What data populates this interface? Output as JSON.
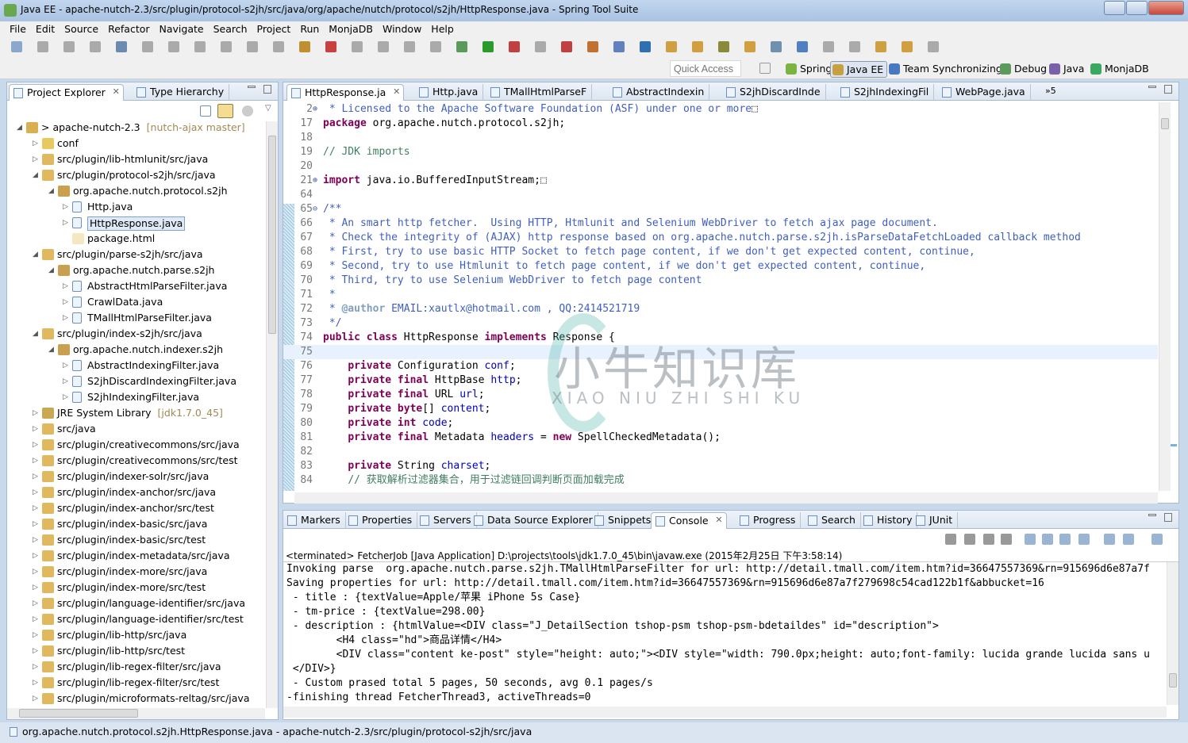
{
  "window": {
    "title": "Java EE - apache-nutch-2.3/src/plugin/protocol-s2jh/src/java/org/apache/nutch/protocol/s2jh/HttpResponse.java - Spring Tool Suite"
  },
  "menu": [
    "File",
    "Edit",
    "Source",
    "Refactor",
    "Navigate",
    "Search",
    "Project",
    "Run",
    "MonjaDB",
    "Window",
    "Help"
  ],
  "quick_access": {
    "placeholder": "Quick Access"
  },
  "perspectives": [
    {
      "label": "Spring",
      "color": "#7cb342"
    },
    {
      "label": "Java EE",
      "color": "#c8a040",
      "active": true
    },
    {
      "label": "Team Synchronizing",
      "color": "#4a78c0"
    },
    {
      "label": "Debug",
      "color": "#5a9a5a"
    },
    {
      "label": "Java",
      "color": "#7a60a8"
    },
    {
      "label": "MonjaDB",
      "color": "#3aa860"
    }
  ],
  "left_panel": {
    "tabs": [
      {
        "label": "Project Explorer",
        "active": true
      },
      {
        "label": "Type Hierarchy"
      }
    ],
    "tree": [
      {
        "level": 0,
        "exp": "open",
        "icon": "project",
        "label": "> apache-nutch-2.3",
        "deco": "[nutch-ajax master]"
      },
      {
        "level": 1,
        "exp": "closed",
        "icon": "folder",
        "label": "conf"
      },
      {
        "level": 1,
        "exp": "closed",
        "icon": "srcfolder",
        "label": "src/plugin/lib-htmlunit/src/java"
      },
      {
        "level": 1,
        "exp": "open",
        "icon": "srcfolder",
        "label": "src/plugin/protocol-s2jh/src/java"
      },
      {
        "level": 2,
        "exp": "open",
        "icon": "package",
        "label": "org.apache.nutch.protocol.s2jh"
      },
      {
        "level": 3,
        "exp": "closed",
        "icon": "java",
        "label": "Http.java"
      },
      {
        "level": 3,
        "exp": "closed",
        "icon": "java",
        "label": "HttpResponse.java",
        "selected": true
      },
      {
        "level": 3,
        "exp": "none",
        "icon": "html",
        "label": "package.html"
      },
      {
        "level": 1,
        "exp": "open",
        "icon": "srcfolder",
        "label": "src/plugin/parse-s2jh/src/java"
      },
      {
        "level": 2,
        "exp": "open",
        "icon": "package",
        "label": "org.apache.nutch.parse.s2jh"
      },
      {
        "level": 3,
        "exp": "closed",
        "icon": "java",
        "label": "AbstractHtmlParseFilter.java"
      },
      {
        "level": 3,
        "exp": "closed",
        "icon": "java",
        "label": "CrawlData.java"
      },
      {
        "level": 3,
        "exp": "closed",
        "icon": "java",
        "label": "TMallHtmlParseFilter.java"
      },
      {
        "level": 1,
        "exp": "open",
        "icon": "srcfolder",
        "label": "src/plugin/index-s2jh/src/java"
      },
      {
        "level": 2,
        "exp": "open",
        "icon": "package",
        "label": "org.apache.nutch.indexer.s2jh"
      },
      {
        "level": 3,
        "exp": "closed",
        "icon": "java",
        "label": "AbstractIndexingFilter.java"
      },
      {
        "level": 3,
        "exp": "closed",
        "icon": "java",
        "label": "S2jhDiscardIndexingFilter.java"
      },
      {
        "level": 3,
        "exp": "closed",
        "icon": "java",
        "label": "S2jhIndexingFilter.java"
      },
      {
        "level": 1,
        "exp": "closed",
        "icon": "library",
        "label": "JRE System Library",
        "deco": "[jdk1.7.0_45]"
      },
      {
        "level": 1,
        "exp": "closed",
        "icon": "srcfolder",
        "label": "src/java"
      },
      {
        "level": 1,
        "exp": "closed",
        "icon": "srcfolder",
        "label": "src/plugin/creativecommons/src/java"
      },
      {
        "level": 1,
        "exp": "closed",
        "icon": "srcfolder",
        "label": "src/plugin/creativecommons/src/test"
      },
      {
        "level": 1,
        "exp": "closed",
        "icon": "srcfolder",
        "label": "src/plugin/indexer-solr/src/java"
      },
      {
        "level": 1,
        "exp": "closed",
        "icon": "srcfolder",
        "label": "src/plugin/index-anchor/src/java"
      },
      {
        "level": 1,
        "exp": "closed",
        "icon": "srcfolder",
        "label": "src/plugin/index-anchor/src/test"
      },
      {
        "level": 1,
        "exp": "closed",
        "icon": "srcfolder",
        "label": "src/plugin/index-basic/src/java"
      },
      {
        "level": 1,
        "exp": "closed",
        "icon": "srcfolder",
        "label": "src/plugin/index-basic/src/test"
      },
      {
        "level": 1,
        "exp": "closed",
        "icon": "srcfolder",
        "label": "src/plugin/index-metadata/src/java"
      },
      {
        "level": 1,
        "exp": "closed",
        "icon": "srcfolder",
        "label": "src/plugin/index-more/src/java"
      },
      {
        "level": 1,
        "exp": "closed",
        "icon": "srcfolder",
        "label": "src/plugin/index-more/src/test"
      },
      {
        "level": 1,
        "exp": "closed",
        "icon": "srcfolder",
        "label": "src/plugin/language-identifier/src/java"
      },
      {
        "level": 1,
        "exp": "closed",
        "icon": "srcfolder",
        "label": "src/plugin/language-identifier/src/test"
      },
      {
        "level": 1,
        "exp": "closed",
        "icon": "srcfolder",
        "label": "src/plugin/lib-http/src/java"
      },
      {
        "level": 1,
        "exp": "closed",
        "icon": "srcfolder",
        "label": "src/plugin/lib-http/src/test"
      },
      {
        "level": 1,
        "exp": "closed",
        "icon": "srcfolder",
        "label": "src/plugin/lib-regex-filter/src/java"
      },
      {
        "level": 1,
        "exp": "closed",
        "icon": "srcfolder",
        "label": "src/plugin/lib-regex-filter/src/test"
      },
      {
        "level": 1,
        "exp": "closed",
        "icon": "srcfolder",
        "label": "src/plugin/microformats-reltag/src/java"
      }
    ]
  },
  "editor": {
    "tabs": [
      {
        "label": "HttpResponse.ja",
        "active": true
      },
      {
        "label": "Http.java"
      },
      {
        "label": "TMallHtmlParseF"
      },
      {
        "label": "AbstractIndexin"
      },
      {
        "label": "S2jhDiscardInde"
      },
      {
        "label": "S2jhIndexingFil"
      },
      {
        "label": "WebPage.java"
      }
    ],
    "overflow": "»5",
    "lines": [
      {
        "n": "2",
        "fold": "+",
        "seg": [
          [
            "jd",
            " * Licensed to the Apache Software Foundation (ASF) under one or more"
          ],
          [
            "tx",
            "⬚"
          ]
        ]
      },
      {
        "n": "17",
        "seg": [
          [
            "kw",
            "package"
          ],
          [
            "tx",
            " org.apache.nutch.protocol.s2jh;"
          ]
        ]
      },
      {
        "n": "18",
        "seg": []
      },
      {
        "n": "19",
        "seg": [
          [
            "cm",
            "// JDK imports"
          ]
        ]
      },
      {
        "n": "20",
        "seg": []
      },
      {
        "n": "21",
        "fold": "+",
        "seg": [
          [
            "kw",
            "import"
          ],
          [
            "tx",
            " java.io.BufferedInputStream;⬚"
          ]
        ]
      },
      {
        "n": "64",
        "seg": []
      },
      {
        "n": "65",
        "fold": "-",
        "seg": [
          [
            "jd",
            "/**"
          ]
        ]
      },
      {
        "n": "66",
        "seg": [
          [
            "jd",
            " * An smart http fetcher.  Using HTTP, Htmlunit and Selenium WebDriver to fetch ajax page document."
          ]
        ]
      },
      {
        "n": "67",
        "seg": [
          [
            "jd",
            " * Check the integrity of (AJAX) http response based on org.apache.nutch.parse.s2jh.isParseDataFetchLoaded callback method"
          ]
        ]
      },
      {
        "n": "68",
        "seg": [
          [
            "jd",
            " * First, try to use basic HTTP Socket to fetch page content, if we don't get expected content, continue,"
          ]
        ]
      },
      {
        "n": "69",
        "seg": [
          [
            "jd",
            " * Second, try to use Htmlunit to fetch page content, if we don't get expected content, continue,"
          ]
        ]
      },
      {
        "n": "70",
        "seg": [
          [
            "jd",
            " * Third, try to use Selenium WebDriver to fetch page content"
          ]
        ]
      },
      {
        "n": "71",
        "seg": [
          [
            "jd",
            " *"
          ]
        ]
      },
      {
        "n": "72",
        "seg": [
          [
            "jd",
            " * "
          ],
          [
            "tag",
            "@author"
          ],
          [
            "jd",
            " EMAIL:xautlx@hotmail.com , QQ:2414521719"
          ]
        ]
      },
      {
        "n": "73",
        "seg": [
          [
            "jd",
            " */"
          ]
        ]
      },
      {
        "n": "74",
        "seg": [
          [
            "kw",
            "public class"
          ],
          [
            "tx",
            " HttpResponse "
          ],
          [
            "kw",
            "implements"
          ],
          [
            "tx",
            " Response {"
          ]
        ]
      },
      {
        "n": "75",
        "seg": [],
        "current": true
      },
      {
        "n": "76",
        "seg": [
          [
            "tx",
            "    "
          ],
          [
            "kw",
            "private"
          ],
          [
            "tx",
            " Configuration "
          ],
          [
            "fd",
            "conf"
          ],
          [
            "tx",
            ";"
          ]
        ]
      },
      {
        "n": "77",
        "seg": [
          [
            "tx",
            "    "
          ],
          [
            "kw",
            "private final"
          ],
          [
            "tx",
            " HttpBase "
          ],
          [
            "fd",
            "http"
          ],
          [
            "tx",
            ";"
          ]
        ]
      },
      {
        "n": "78",
        "seg": [
          [
            "tx",
            "    "
          ],
          [
            "kw",
            "private final"
          ],
          [
            "tx",
            " URL "
          ],
          [
            "fd",
            "url"
          ],
          [
            "tx",
            ";"
          ]
        ]
      },
      {
        "n": "79",
        "seg": [
          [
            "tx",
            "    "
          ],
          [
            "kw",
            "private byte"
          ],
          [
            "tx",
            "[] "
          ],
          [
            "fd",
            "content"
          ],
          [
            "tx",
            ";"
          ]
        ]
      },
      {
        "n": "80",
        "seg": [
          [
            "tx",
            "    "
          ],
          [
            "kw",
            "private int"
          ],
          [
            "tx",
            " "
          ],
          [
            "fd",
            "code"
          ],
          [
            "tx",
            ";"
          ]
        ]
      },
      {
        "n": "81",
        "seg": [
          [
            "tx",
            "    "
          ],
          [
            "kw",
            "private final"
          ],
          [
            "tx",
            " Metadata "
          ],
          [
            "fd",
            "headers"
          ],
          [
            "tx",
            " = "
          ],
          [
            "kw",
            "new"
          ],
          [
            "tx",
            " SpellCheckedMetadata();"
          ]
        ]
      },
      {
        "n": "82",
        "seg": []
      },
      {
        "n": "83",
        "seg": [
          [
            "tx",
            "    "
          ],
          [
            "kw",
            "private"
          ],
          [
            "tx",
            " String "
          ],
          [
            "fd",
            "charset"
          ],
          [
            "tx",
            ";"
          ]
        ]
      },
      {
        "n": "84",
        "seg": [
          [
            "tx",
            "    "
          ],
          [
            "cm",
            "// 获取解析过滤器集合，用于过滤链回调判断页面加载完成"
          ]
        ]
      }
    ]
  },
  "watermark": {
    "cn": "小牛知识库",
    "en": "XIAO NIU ZHI SHI KU"
  },
  "bottom_panel": {
    "tabs": [
      {
        "label": "Markers"
      },
      {
        "label": "Properties"
      },
      {
        "label": "Servers"
      },
      {
        "label": "Data Source Explorer"
      },
      {
        "label": "Snippets"
      },
      {
        "label": "Console",
        "active": true
      },
      {
        "label": "Progress"
      },
      {
        "label": "Search"
      },
      {
        "label": "History"
      },
      {
        "label": "JUnit"
      }
    ],
    "terminated": "<terminated> FetcherJob [Java Application] D:\\projects\\tools\\jdk1.7.0_45\\bin\\javaw.exe (2015年2月25日 下午3:58:14)",
    "console_lines": [
      "Invoking parse  org.apache.nutch.parse.s2jh.TMallHtmlParseFilter for url: http://detail.tmall.com/item.htm?id=36647557369&rn=915696d6e87a7f",
      "Saving properties for url: http://detail.tmall.com/item.htm?id=36647557369&rn=915696d6e87a7f279698c54cad122b1f&abbucket=16",
      " - title : {textValue=Apple/苹果 iPhone 5s Case}",
      " - tm-price : {textValue=298.00}",
      " - description : {htmlValue=<DIV class=\"J_DetailSection tshop-psm tshop-psm-bdetaildes\" id=\"description\">",
      "        <H4 class=\"hd\">商品详情</H4>",
      "        <DIV class=\"content ke-post\" style=\"height: auto;\"><DIV style=\"width: 790.0px;height: auto;font-family: lucida grande lucida sans u",
      " </DIV>}",
      " - Custom prased total 5 pages, 50 seconds, avg 0.1 pages/s",
      "-finishing thread FetcherThread3, activeThreads=0"
    ]
  },
  "status_bar": {
    "text": "org.apache.nutch.protocol.s2jh.HttpResponse.java - apache-nutch-2.3/src/plugin/protocol-s2jh/src/java"
  }
}
